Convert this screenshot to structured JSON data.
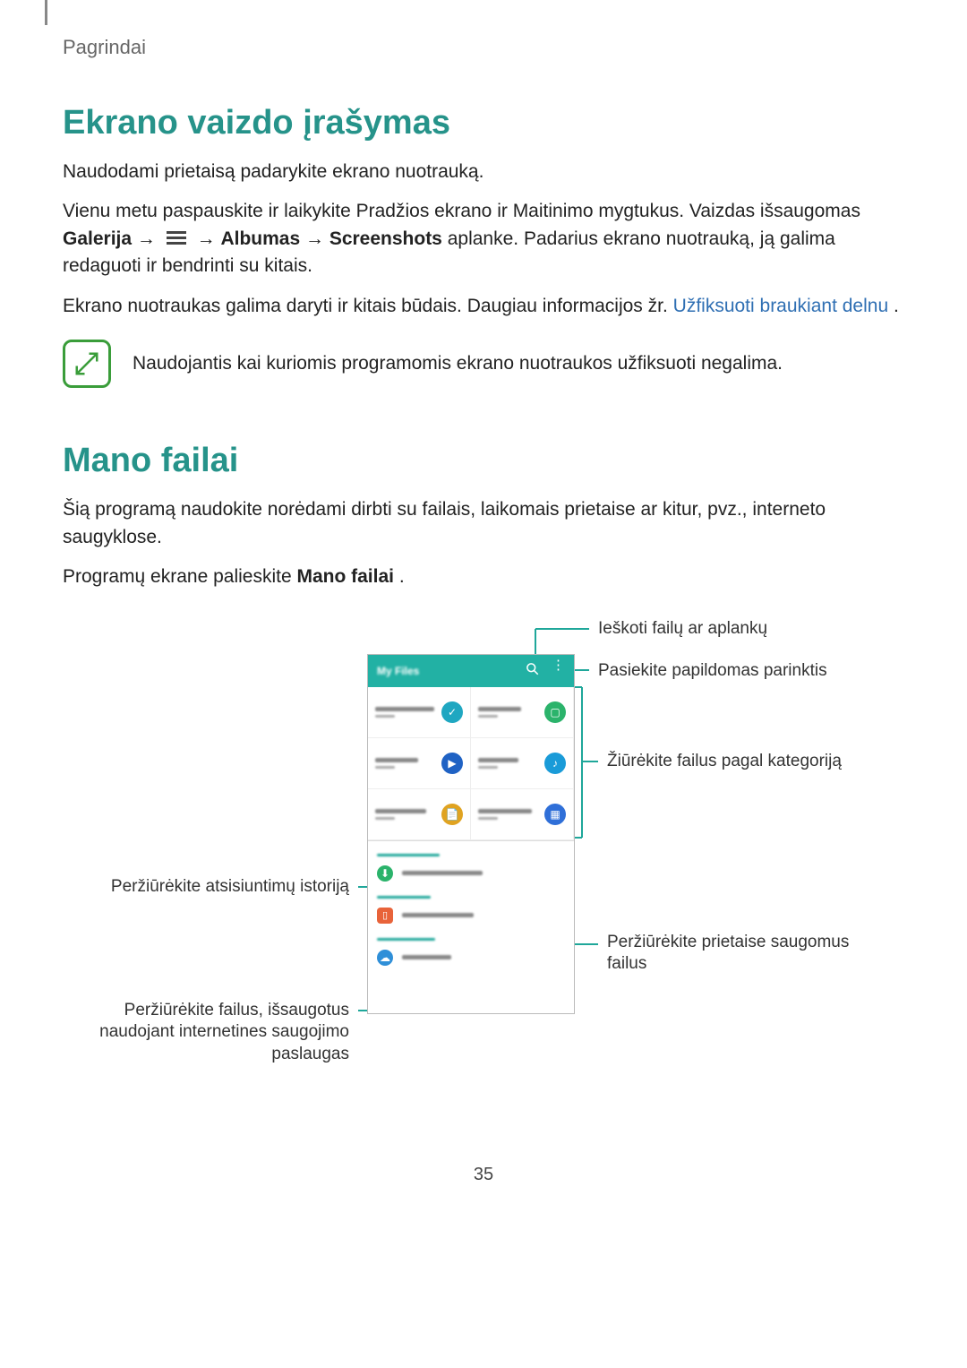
{
  "header": {
    "section": "Pagrindai"
  },
  "screenshot": {
    "heading": "Ekrano vaizdo įrašymas",
    "p1": "Naudodami prietaisą padarykite ekrano nuotrauką.",
    "p2a": "Vienu metu paspauskite ir laikykite Pradžios ekrano ir Maitinimo mygtukus. Vaizdas išsaugomas ",
    "p2_gallery": "Galerija",
    "p2_albums": "Albumas",
    "p2_screenshots": "Screenshots",
    "p2b": " aplanke. Padarius ekrano nuotrauką, ją galima redaguoti ir bendrinti su kitais.",
    "p3a": "Ekrano nuotraukas galima daryti ir kitais būdais. Daugiau informacijos žr. ",
    "p3_link": "Užfiksuoti braukiant delnu",
    "p3b": ".",
    "note": "Naudojantis kai kuriomis programomis ekrano nuotraukos užfiksuoti negalima."
  },
  "myfiles": {
    "heading": "Mano failai",
    "p1": "Šią programą naudokite norėdami dirbti su failais, laikomais prietaise ar kitur, pvz., interneto saugyklose.",
    "p2a": "Programų ekrane palieskite ",
    "p2b": "Mano failai",
    "p2c": "."
  },
  "diagram": {
    "app_title": "My Files",
    "categories": [
      {
        "label": "Recent files",
        "sub": "0.00B",
        "color": "#1fa7c1",
        "icon": "✓"
      },
      {
        "label": "Images",
        "sub": "0.00B",
        "color": "#2bb36b",
        "icon": "▢"
      },
      {
        "label": "Videos",
        "sub": "0.00B",
        "color": "#1f62c4",
        "icon": "▶"
      },
      {
        "label": "Audio",
        "sub": "0.00B",
        "color": "#1a9bd8",
        "icon": "♪"
      },
      {
        "label": "Documents",
        "sub": "0.00B",
        "color": "#e0a321",
        "icon": "📄"
      },
      {
        "label": "Downloaded",
        "sub": "apps",
        "color": "#2f6fd8",
        "icon": "▦"
      }
    ],
    "sections": {
      "download_history_head": "Download history",
      "download_history_item": "Download history",
      "local_storage_head": "Local storage",
      "local_storage_item": "Device storage",
      "cloud_storage_head": "Cloud storage",
      "cloud_storage_item": "Dropbox"
    },
    "callouts": {
      "search": "Ieškoti failų ar aplankų",
      "options": "Pasiekite papildomas parinktis",
      "category": "Žiūrėkite failus pagal kategoriją",
      "downloads": "Peržiūrėkite atsisiuntimų istoriją",
      "device": "Peržiūrėkite prietaise saugomus failus",
      "cloud": "Peržiūrėkite failus, išsaugotus naudojant internetines saugojimo paslaugas"
    }
  },
  "page_number": "35"
}
